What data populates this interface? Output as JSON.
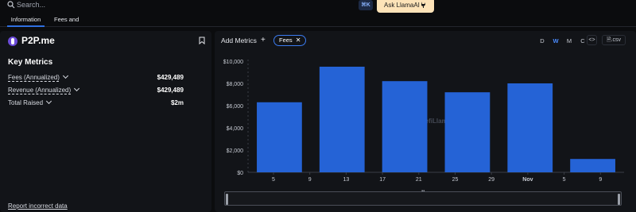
{
  "topbar": {
    "search_placeholder": "Search...",
    "shortcut": "⌘K",
    "ask_label": "Ask LlamaAI"
  },
  "tabs": [
    {
      "label": "Information",
      "active": true
    },
    {
      "label": "Fees and Revenue",
      "active": false
    }
  ],
  "protocol": {
    "name": "P2P.me",
    "logo_color": "#6b4bd8"
  },
  "key_metrics": {
    "title": "Key Metrics",
    "rows": [
      {
        "label": "Fees (Annualized)",
        "value": "$429,489"
      },
      {
        "label": "Revenue (Annualized)",
        "value": "$429,489"
      },
      {
        "label": "Total Raised",
        "value": "$2m"
      }
    ]
  },
  "report_link": "Report incorrect data",
  "chart_controls": {
    "add_metrics": "Add Metrics",
    "plus": "+",
    "chip": "Fees",
    "chip_close": "✕",
    "periods": [
      {
        "label": "D",
        "active": false
      },
      {
        "label": "W",
        "active": true
      },
      {
        "label": "M",
        "active": false
      },
      {
        "label": "C",
        "active": false
      }
    ],
    "embed": "<>",
    "csv": ".csv"
  },
  "chart_data": {
    "type": "bar",
    "series": [
      {
        "name": "Fees",
        "color": "#2563d6",
        "values": [
          6300,
          9500,
          8200,
          7200,
          8000,
          1200
        ]
      }
    ],
    "bar_centers": [
      "Oct 5",
      "Oct 12",
      "Oct 19",
      "Oct 26",
      "Nov 2",
      "Nov 9"
    ],
    "x_ticks": [
      "5",
      "9",
      "13",
      "17",
      "21",
      "25",
      "29",
      "Nov",
      "5",
      "9"
    ],
    "y_ticks": [
      "$0",
      "$2,000",
      "$4,000",
      "$6,000",
      "$8,000",
      "$10,000"
    ],
    "ylim": [
      0,
      10000
    ],
    "watermark": "DefiLlama",
    "grid": false
  },
  "colors": {
    "accent": "#2f6fe0",
    "bar": "#2563d6",
    "ask_bg": "#fde3b8"
  }
}
